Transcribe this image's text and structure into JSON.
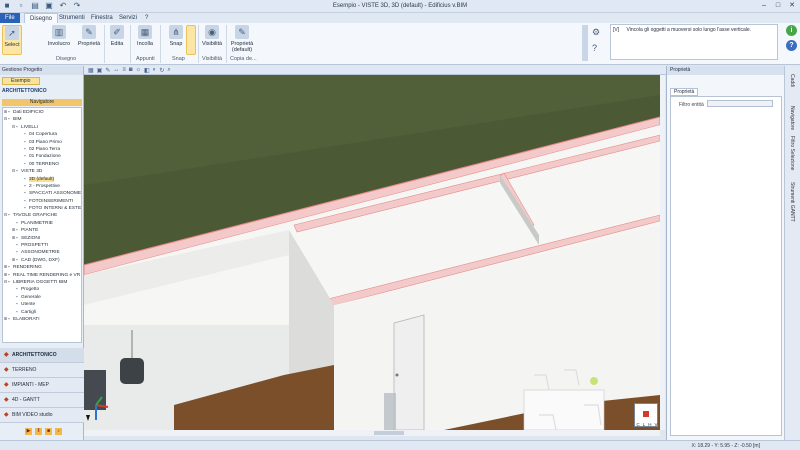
{
  "window": {
    "title": "Esempio - VISTE 3D, 3D (default) - Edificius v.BIM"
  },
  "menu": {
    "tabs": [
      "File",
      "Disegno",
      "Strumenti",
      "Finestra",
      "Servizi",
      "?"
    ]
  },
  "ribbon": {
    "buttons": [
      "Select",
      "Involucro",
      "Proprietà",
      "Edita",
      "Incolla",
      "Snap",
      "Visibilità",
      "Proprietà (default)"
    ],
    "groups": [
      "Disegno",
      "Appunti",
      "Snap",
      "Visibilità",
      "Copia de..."
    ]
  },
  "messages": {
    "number": "[V]",
    "text": "Vincola gli oggetti a muoversi solo lungo l'asse verticale."
  },
  "navigator": {
    "panel_title": "Gestione Progetto",
    "project_tab": "Esempio",
    "section": "ARCHITETTONICO",
    "header": "Navigatore",
    "tree": [
      {
        "label": "Dati EDIFICIO",
        "toggle": "+",
        "level": 0
      },
      {
        "label": "BIM",
        "toggle": "-",
        "level": 0
      },
      {
        "label": "LIVELLI",
        "toggle": "-",
        "level": 1
      },
      {
        "label": "04 Copertura",
        "toggle": "",
        "level": 2
      },
      {
        "label": "03 Piano Primo",
        "toggle": "",
        "level": 2
      },
      {
        "label": "02 Piano Terra",
        "toggle": "",
        "level": 2
      },
      {
        "label": "01 Fondazione",
        "toggle": "",
        "level": 2
      },
      {
        "label": "00 TERRENO",
        "toggle": "",
        "level": 2
      },
      {
        "label": "VISTE 3D",
        "toggle": "-",
        "level": 1
      },
      {
        "label": "3D (default)",
        "toggle": "",
        "level": 2,
        "selected": true
      },
      {
        "label": "2 - Prospettive",
        "toggle": "",
        "level": 2
      },
      {
        "label": "SPACCATI ASSONOMETRICI",
        "toggle": "",
        "level": 2
      },
      {
        "label": "FOTOINSERIMENTI",
        "toggle": "",
        "level": 2
      },
      {
        "label": "FOTO INTERNI & ESTERNI",
        "toggle": "",
        "level": 2
      },
      {
        "label": "TAVOLE GRAFICHE",
        "toggle": "-",
        "level": 0
      },
      {
        "label": "PLANIMETRIE",
        "toggle": "",
        "level": 1
      },
      {
        "label": "PIANTE",
        "toggle": "+",
        "level": 1
      },
      {
        "label": "SEZIONI",
        "toggle": "+",
        "level": 1
      },
      {
        "label": "PROSPETTI",
        "toggle": "",
        "level": 1
      },
      {
        "label": "ASSONOMETRIE",
        "toggle": "",
        "level": 1
      },
      {
        "label": "CAD (DWG, DXF)",
        "toggle": "+",
        "level": 1
      },
      {
        "label": "RENDERING",
        "toggle": "+",
        "level": 0
      },
      {
        "label": "REAL TIME RENDERING e VR",
        "toggle": "+",
        "level": 0
      },
      {
        "label": "LIBRERIA OGGETTI BIM",
        "toggle": "-",
        "level": 0
      },
      {
        "label": "Progetto",
        "toggle": "",
        "level": 1
      },
      {
        "label": "Generale",
        "toggle": "",
        "level": 1
      },
      {
        "label": "Utente",
        "toggle": "",
        "level": 1
      },
      {
        "label": "Cartigli",
        "toggle": "",
        "level": 1
      },
      {
        "label": "ELABORATI",
        "toggle": "+",
        "level": 0
      }
    ],
    "modules": [
      "ARCHITETTONICO",
      "TERRENO",
      "IMPIANTI - MEP",
      "4D - GANTT",
      "BIM VIDEO studio"
    ]
  },
  "properties": {
    "title": "Proprietà",
    "tab": "Proprietà",
    "filter_label": "Filtro entità"
  },
  "right_strip": [
    "Caddi",
    "Navigatore",
    "Filtro Selezione",
    "Strumenti GANTT"
  ],
  "viewcube": [
    "C",
    "L",
    "H",
    "V"
  ],
  "status": {
    "coords": "X: 18.29 - Y: 5.95 - Z: -0.50 [m]"
  },
  "colors": {
    "accent": "#2a62b8",
    "highlight": "#f9e08f",
    "grass": "#4b5a35",
    "wall": "#f4f4f2",
    "roof_edge": "#e88a8a"
  }
}
